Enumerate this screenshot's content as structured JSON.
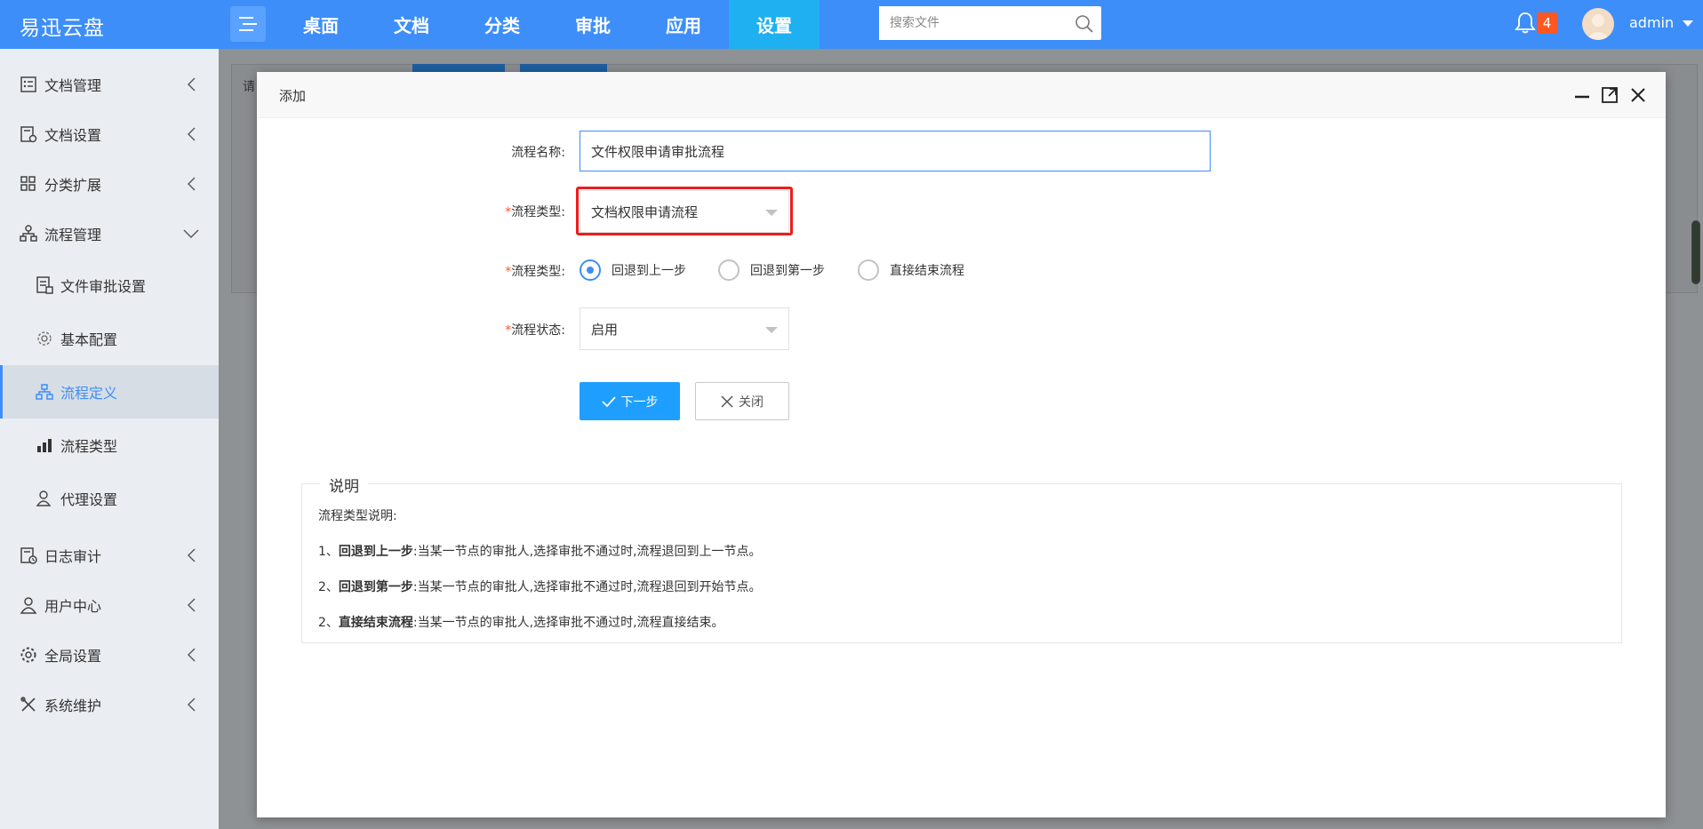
{
  "brand": "易迅云盘",
  "nav": {
    "items": [
      {
        "label": "桌面"
      },
      {
        "label": "文档"
      },
      {
        "label": "分类"
      },
      {
        "label": "审批"
      },
      {
        "label": "应用"
      },
      {
        "label": "设置"
      }
    ],
    "active": "设置"
  },
  "search": {
    "placeholder": "搜索文件"
  },
  "notifications": {
    "count": "4"
  },
  "user": {
    "name": "admin"
  },
  "sidebar": {
    "items": [
      {
        "label": "文档管理",
        "icon": "checklist-icon"
      },
      {
        "label": "文档设置",
        "icon": "doc-settings-icon"
      },
      {
        "label": "分类扩展",
        "icon": "grid-icon"
      },
      {
        "label": "流程管理",
        "icon": "flow-icon"
      },
      {
        "label": "日志审计",
        "icon": "log-icon"
      },
      {
        "label": "用户中心",
        "icon": "user-icon"
      },
      {
        "label": "全局设置",
        "icon": "gear-icon"
      },
      {
        "label": "系统维护",
        "icon": "tools-icon"
      }
    ],
    "subitems": [
      {
        "label": "文件审批设置",
        "icon": "file-approval-icon"
      },
      {
        "label": "基本配置",
        "icon": "gear-icon"
      },
      {
        "label": "流程定义",
        "icon": "flow-definition-icon"
      },
      {
        "label": "流程类型",
        "icon": "chart-icon"
      },
      {
        "label": "代理设置",
        "icon": "user-icon"
      }
    ],
    "active_subitem": "流程定义"
  },
  "dialog": {
    "title": "添加",
    "fields": {
      "name_label": "流程名称:",
      "name_value": "文件权限申请审批流程",
      "type_label": "流程类型:",
      "type_value": "文档权限申请流程",
      "reject_label": "流程类型:",
      "reject_options": [
        "回退到上一步",
        "回退到第一步",
        "直接结束流程"
      ],
      "reject_selected": "回退到上一步",
      "status_label": "流程状态:",
      "status_value": "启用"
    },
    "buttons": {
      "next": "下一步",
      "close": "关闭"
    },
    "notes": {
      "legend": "说明",
      "intro": "流程类型说明:",
      "lines": [
        {
          "prefix": "1、",
          "term": "回退到上一步",
          "desc": ":当某一节点的审批人,选择审批不通过时,流程退回到上一节点。"
        },
        {
          "prefix": "2、",
          "term": "回退到第一步",
          "desc": ":当某一节点的审批人,选择审批不通过时,流程退回到开始节点。"
        },
        {
          "prefix": "2、",
          "term": "直接结束流程",
          "desc": ":当某一节点的审批人,选择审批不通过时,流程直接结束。"
        }
      ]
    }
  },
  "background": {
    "partial_input_char": "请"
  },
  "colors": {
    "topbar": "#3d8ef8",
    "nav_active": "#1eb0f0",
    "primary_button": "#1e9fff",
    "highlight_box": "#ee1c1c",
    "badge": "#ff5722"
  }
}
